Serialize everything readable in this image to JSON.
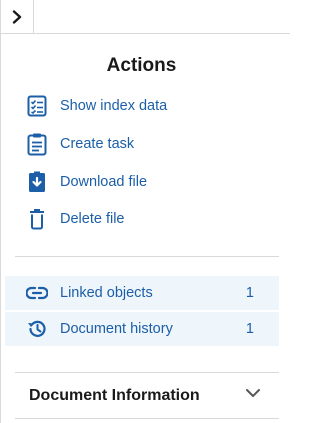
{
  "header": {
    "collapse_icon": "chevron-right-icon"
  },
  "actions": {
    "title": "Actions",
    "items": [
      {
        "label": "Show index data",
        "icon": "checklist-icon"
      },
      {
        "label": "Create task",
        "icon": "clipboard-icon"
      },
      {
        "label": "Download file",
        "icon": "download-icon"
      },
      {
        "label": "Delete file",
        "icon": "trash-icon"
      }
    ]
  },
  "links": [
    {
      "label": "Linked objects",
      "count": "1",
      "icon": "link-icon"
    },
    {
      "label": "Document history",
      "count": "1",
      "icon": "history-icon"
    }
  ],
  "document_info": {
    "label": "Document Information",
    "icon": "chevron-down-icon"
  },
  "colors": {
    "accent": "#1c5fa8",
    "row_background": "#eef5fb",
    "divider": "#d9d9d9"
  }
}
